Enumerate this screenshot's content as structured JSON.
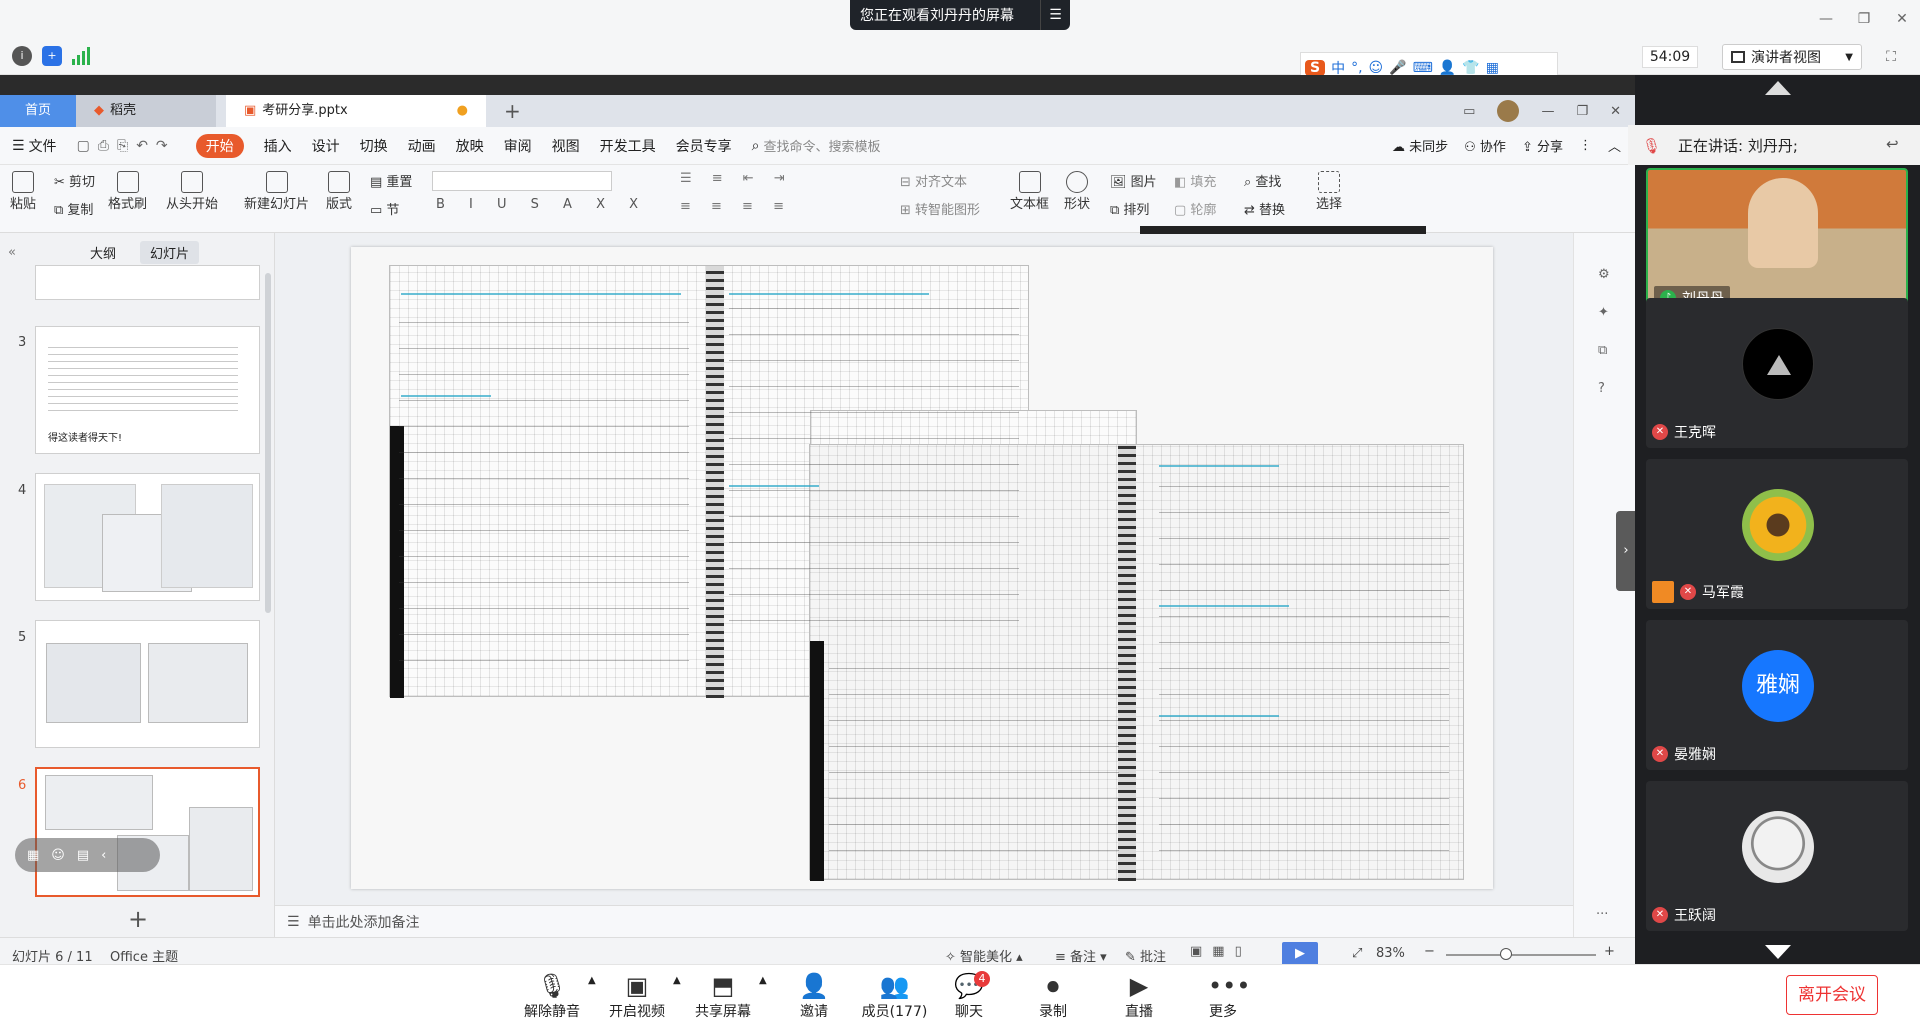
{
  "meeting": {
    "banner": "您正在观看刘丹丹的屏幕",
    "timer": "54:09",
    "speaker_view": "演讲者视图",
    "speaking_now": "正在讲话: 刘丹丹;",
    "leave": "离开会议"
  },
  "ime": {
    "lang": "中",
    "punct": "°,"
  },
  "wps": {
    "tabs": [
      "首页",
      "稻壳",
      "考研分享.pptx"
    ],
    "menus": [
      "文件",
      "开始",
      "插入",
      "设计",
      "切换",
      "动画",
      "放映",
      "审阅",
      "视图",
      "开发工具",
      "会员专享"
    ],
    "search_cmd": "查找命令、搜索模板",
    "sync": "未同步",
    "collab": "协作",
    "share": "分享"
  },
  "ribbon": {
    "paste": "粘贴",
    "cut": "剪切",
    "copy": "复制",
    "format_painter": "格式刷",
    "from_start": "从头开始",
    "new_slide": "新建幻灯片",
    "layout": "版式",
    "section": "节",
    "reset": "重置",
    "text_box": "文本框",
    "shape": "形状",
    "picture": "图片",
    "arrange": "排列",
    "find": "查找",
    "replace": "替换",
    "select": "选择",
    "align_text": "对齐文本",
    "to_smartart": "转智能图形",
    "fill": "填充",
    "outline": "轮廓"
  },
  "panel": {
    "tab_outline": "大纲",
    "tab_slides": "幻灯片",
    "slide_numbers": [
      "3",
      "4",
      "5",
      "6"
    ],
    "slide3_text": "得这读者得天下!",
    "add": "+"
  },
  "notes_placeholder": "单击此处添加备注",
  "status": {
    "slide_pos": "幻灯片 6 / 11",
    "theme": "Office 主题",
    "beautify": "智能美化",
    "notes": "备注",
    "comments": "批注",
    "zoom": "83%"
  },
  "participants": [
    {
      "name": "刘丹丹",
      "muted": false
    },
    {
      "name": "王克晖",
      "muted": true
    },
    {
      "name": "马军霞",
      "muted": true
    },
    {
      "name": "晏雅娴",
      "muted": true,
      "avatar_text": "雅娴"
    },
    {
      "name": "王跃阔",
      "muted": true
    }
  ],
  "bottom": {
    "mute": "解除静音",
    "video": "开启视频",
    "share": "共享屏幕",
    "invite": "邀请",
    "members": "成员(177)",
    "chat": "聊天",
    "chat_badge": "4",
    "record": "录制",
    "live": "直播",
    "more": "更多"
  },
  "colors": {
    "accent": "#e85a2c",
    "home_tab": "#4f8fe8",
    "leave": "#e33333",
    "avatar_blue": "#1677ff"
  }
}
